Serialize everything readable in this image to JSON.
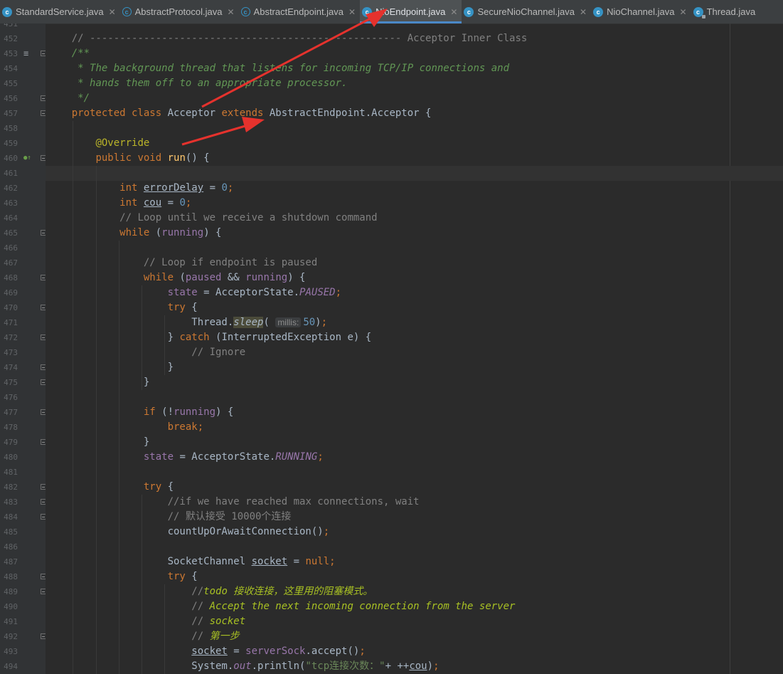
{
  "tabs": [
    {
      "label": "StandardService.java",
      "icon": "class-icon",
      "active": false,
      "closable": true
    },
    {
      "label": "AbstractProtocol.java",
      "icon": "abstract-class-icon",
      "active": false,
      "closable": true
    },
    {
      "label": "AbstractEndpoint.java",
      "icon": "abstract-class-icon",
      "active": false,
      "closable": true
    },
    {
      "label": "NioEndpoint.java",
      "icon": "class-icon",
      "active": true,
      "closable": true
    },
    {
      "label": "SecureNioChannel.java",
      "icon": "class-icon",
      "active": false,
      "closable": true
    },
    {
      "label": "NioChannel.java",
      "icon": "class-icon",
      "active": false,
      "closable": true
    },
    {
      "label": "Thread.java",
      "icon": "locked-class-icon",
      "active": false,
      "closable": false
    }
  ],
  "close_glyph": "✕",
  "class_icon_glyph": "c",
  "colors": {
    "keyword": "#cc7832",
    "comment": "#808080",
    "doc_comment": "#629755",
    "annotation": "#bbb529",
    "method": "#ffc66d",
    "number": "#6897bb",
    "constant": "#9876aa",
    "string": "#6a8759",
    "todo": "#a8c023",
    "arrow": "#e5322d",
    "active_tab_underline": "#4a88c7"
  },
  "lines": [
    {
      "n": "451",
      "fold": "",
      "mark": "",
      "tokens": []
    },
    {
      "n": "452",
      "fold": "",
      "mark": "",
      "tokens": [
        {
          "t": "    "
        },
        {
          "c": "cm",
          "t": "// ---------------------------------------------------- Acceptor Inner Class"
        }
      ]
    },
    {
      "n": "453",
      "fold": "open",
      "mark": "doc-icon",
      "tokens": [
        {
          "t": "    "
        },
        {
          "c": "dc",
          "t": "/**"
        }
      ]
    },
    {
      "n": "454",
      "fold": "",
      "mark": "",
      "tokens": [
        {
          "t": "     "
        },
        {
          "c": "dc",
          "t": "* The background thread that listens for incoming TCP/IP connections and"
        }
      ]
    },
    {
      "n": "455",
      "fold": "",
      "mark": "",
      "tokens": [
        {
          "t": "     "
        },
        {
          "c": "dc",
          "t": "* hands them off to an appropriate processor."
        }
      ]
    },
    {
      "n": "456",
      "fold": "open",
      "mark": "",
      "tokens": [
        {
          "t": "     "
        },
        {
          "c": "dc",
          "t": "*/"
        }
      ]
    },
    {
      "n": "457",
      "fold": "open",
      "mark": "",
      "tokens": [
        {
          "t": "    "
        },
        {
          "c": "kw",
          "t": "protected class "
        },
        {
          "t": "Acceptor "
        },
        {
          "c": "kw",
          "t": "extends "
        },
        {
          "t": "AbstractEndpoint.Acceptor {"
        }
      ]
    },
    {
      "n": "458",
      "fold": "",
      "mark": "",
      "tokens": []
    },
    {
      "n": "459",
      "fold": "",
      "mark": "",
      "tokens": [
        {
          "t": "        "
        },
        {
          "c": "an",
          "t": "@Override"
        }
      ]
    },
    {
      "n": "460",
      "fold": "open",
      "mark": "override-icon",
      "tokens": [
        {
          "t": "        "
        },
        {
          "c": "kw",
          "t": "public void "
        },
        {
          "c": "fn",
          "t": "run"
        },
        {
          "t": "() {"
        }
      ]
    },
    {
      "n": "461",
      "fold": "",
      "mark": "",
      "current": true,
      "tokens": []
    },
    {
      "n": "462",
      "fold": "",
      "mark": "",
      "tokens": [
        {
          "t": "            "
        },
        {
          "c": "kw",
          "t": "int "
        },
        {
          "c": "ul",
          "t": "errorDelay"
        },
        {
          "t": " = "
        },
        {
          "c": "nm",
          "t": "0"
        },
        {
          "c": "kw",
          "t": ";"
        }
      ]
    },
    {
      "n": "463",
      "fold": "",
      "mark": "",
      "tokens": [
        {
          "t": "            "
        },
        {
          "c": "kw",
          "t": "int "
        },
        {
          "c": "ul",
          "t": "cou"
        },
        {
          "t": " = "
        },
        {
          "c": "nm",
          "t": "0"
        },
        {
          "c": "kw",
          "t": ";"
        }
      ]
    },
    {
      "n": "464",
      "fold": "",
      "mark": "",
      "tokens": [
        {
          "t": "            "
        },
        {
          "c": "cm",
          "t": "// Loop until we receive a shutdown command"
        }
      ]
    },
    {
      "n": "465",
      "fold": "open",
      "mark": "",
      "tokens": [
        {
          "t": "            "
        },
        {
          "c": "kw",
          "t": "while "
        },
        {
          "t": "("
        },
        {
          "c": "fl",
          "t": "running"
        },
        {
          "t": ") {"
        }
      ]
    },
    {
      "n": "466",
      "fold": "",
      "mark": "",
      "tokens": []
    },
    {
      "n": "467",
      "fold": "",
      "mark": "",
      "tokens": [
        {
          "t": "                "
        },
        {
          "c": "cm",
          "t": "// Loop if endpoint is paused"
        }
      ]
    },
    {
      "n": "468",
      "fold": "open",
      "mark": "",
      "tokens": [
        {
          "t": "                "
        },
        {
          "c": "kw",
          "t": "while "
        },
        {
          "t": "("
        },
        {
          "c": "fl",
          "t": "paused"
        },
        {
          "t": " && "
        },
        {
          "c": "fl",
          "t": "running"
        },
        {
          "t": ") {"
        }
      ]
    },
    {
      "n": "469",
      "fold": "",
      "mark": "",
      "tokens": [
        {
          "t": "                    "
        },
        {
          "c": "fl",
          "t": "state"
        },
        {
          "t": " = AcceptorState."
        },
        {
          "c": "cn",
          "t": "PAUSED"
        },
        {
          "c": "kw",
          "t": ";"
        }
      ]
    },
    {
      "n": "470",
      "fold": "open",
      "mark": "",
      "tokens": [
        {
          "t": "                    "
        },
        {
          "c": "kw",
          "t": "try "
        },
        {
          "t": "{"
        }
      ]
    },
    {
      "n": "471",
      "fold": "",
      "mark": "",
      "tokens": [
        {
          "t": "                        Thread."
        },
        {
          "c": "hl",
          "t": "sleep"
        },
        {
          "t": "( "
        },
        {
          "c": "hint",
          "t": "millis:"
        },
        {
          "c": "nm",
          "t": "50"
        },
        {
          "t": ")"
        },
        {
          "c": "kw",
          "t": ";"
        }
      ]
    },
    {
      "n": "472",
      "fold": "open",
      "mark": "",
      "tokens": [
        {
          "t": "                    } "
        },
        {
          "c": "kw",
          "t": "catch "
        },
        {
          "t": "(InterruptedException e) {"
        }
      ]
    },
    {
      "n": "473",
      "fold": "",
      "mark": "",
      "tokens": [
        {
          "t": "                        "
        },
        {
          "c": "cm",
          "t": "// Ignore"
        }
      ]
    },
    {
      "n": "474",
      "fold": "open",
      "mark": "",
      "tokens": [
        {
          "t": "                    }"
        }
      ]
    },
    {
      "n": "475",
      "fold": "open",
      "mark": "",
      "tokens": [
        {
          "t": "                }"
        }
      ]
    },
    {
      "n": "476",
      "fold": "",
      "mark": "",
      "tokens": []
    },
    {
      "n": "477",
      "fold": "open",
      "mark": "",
      "tokens": [
        {
          "t": "                "
        },
        {
          "c": "kw",
          "t": "if "
        },
        {
          "t": "(!"
        },
        {
          "c": "fl",
          "t": "running"
        },
        {
          "t": ") {"
        }
      ]
    },
    {
      "n": "478",
      "fold": "",
      "mark": "",
      "tokens": [
        {
          "t": "                    "
        },
        {
          "c": "kw",
          "t": "break;"
        }
      ]
    },
    {
      "n": "479",
      "fold": "open",
      "mark": "",
      "tokens": [
        {
          "t": "                }"
        }
      ]
    },
    {
      "n": "480",
      "fold": "",
      "mark": "",
      "tokens": [
        {
          "t": "                "
        },
        {
          "c": "fl",
          "t": "state"
        },
        {
          "t": " = AcceptorState."
        },
        {
          "c": "cn",
          "t": "RUNNING"
        },
        {
          "c": "kw",
          "t": ";"
        }
      ]
    },
    {
      "n": "481",
      "fold": "",
      "mark": "",
      "tokens": []
    },
    {
      "n": "482",
      "fold": "open",
      "mark": "",
      "tokens": [
        {
          "t": "                "
        },
        {
          "c": "kw",
          "t": "try "
        },
        {
          "t": "{"
        }
      ]
    },
    {
      "n": "483",
      "fold": "open",
      "mark": "",
      "tokens": [
        {
          "t": "                    "
        },
        {
          "c": "cm",
          "t": "//if we have reached max connections, wait"
        }
      ]
    },
    {
      "n": "484",
      "fold": "open",
      "mark": "",
      "tokens": [
        {
          "t": "                    "
        },
        {
          "c": "cm",
          "t": "// 默认接受 10000个连接"
        }
      ]
    },
    {
      "n": "485",
      "fold": "",
      "mark": "",
      "tokens": [
        {
          "t": "                    countUpOrAwaitConnection()"
        },
        {
          "c": "kw",
          "t": ";"
        }
      ]
    },
    {
      "n": "486",
      "fold": "",
      "mark": "",
      "tokens": []
    },
    {
      "n": "487",
      "fold": "",
      "mark": "",
      "tokens": [
        {
          "t": "                    SocketChannel "
        },
        {
          "c": "ul",
          "t": "socket"
        },
        {
          "t": " = "
        },
        {
          "c": "kw",
          "t": "null;"
        }
      ]
    },
    {
      "n": "488",
      "fold": "open",
      "mark": "",
      "tokens": [
        {
          "t": "                    "
        },
        {
          "c": "kw",
          "t": "try "
        },
        {
          "t": "{"
        }
      ]
    },
    {
      "n": "489",
      "fold": "open",
      "mark": "",
      "tokens": [
        {
          "t": "                        "
        },
        {
          "c": "cm",
          "t": "//"
        },
        {
          "c": "todo",
          "t": "todo 接收连接，这里用的阻塞模式。"
        }
      ]
    },
    {
      "n": "490",
      "fold": "",
      "mark": "",
      "tokens": [
        {
          "t": "                        "
        },
        {
          "c": "cm",
          "t": "// "
        },
        {
          "c": "todo",
          "t": "Accept the next incoming connection from the server"
        }
      ]
    },
    {
      "n": "491",
      "fold": "",
      "mark": "",
      "tokens": [
        {
          "t": "                        "
        },
        {
          "c": "cm",
          "t": "// "
        },
        {
          "c": "todo",
          "t": "socket"
        }
      ]
    },
    {
      "n": "492",
      "fold": "open",
      "mark": "",
      "tokens": [
        {
          "t": "                        "
        },
        {
          "c": "cm",
          "t": "// "
        },
        {
          "c": "todo",
          "t": "第一步"
        }
      ]
    },
    {
      "n": "493",
      "fold": "",
      "mark": "",
      "tokens": [
        {
          "t": "                        "
        },
        {
          "c": "ul",
          "t": "socket"
        },
        {
          "t": " = "
        },
        {
          "c": "fl",
          "t": "serverSock"
        },
        {
          "t": ".accept()"
        },
        {
          "c": "kw",
          "t": ";"
        }
      ]
    },
    {
      "n": "494",
      "fold": "",
      "mark": "",
      "tokens": [
        {
          "t": "                        System."
        },
        {
          "c": "cn",
          "t": "out"
        },
        {
          "t": ".println("
        },
        {
          "c": "st",
          "t": "\"tcp连接次数：\""
        },
        {
          "t": "+ ++"
        },
        {
          "c": "ul",
          "t": "cou"
        },
        {
          "t": ")"
        },
        {
          "c": "kw",
          "t": ";"
        }
      ]
    }
  ]
}
